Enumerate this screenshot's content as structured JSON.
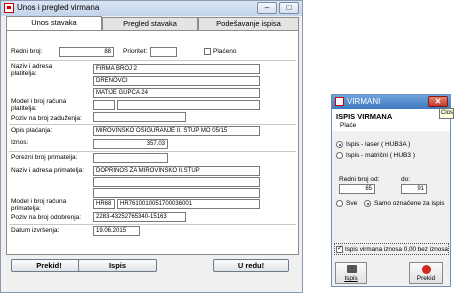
{
  "window": {
    "title": "Unos i pregled virmana"
  },
  "tabs": [
    "Unos stavaka",
    "Pregled stavaka",
    "Podešavanje ispisa"
  ],
  "form": {
    "redni_broj_label": "Redni broj:",
    "redni_broj": "88",
    "prioritet_label": "Prioritet:",
    "prioritet": "",
    "placeno_label": "Plaćeno",
    "platitelj_label": "Naziv i adresa platitelja:",
    "platitelj_line1": "FIRMA BROJ 2",
    "platitelj_line2": "DRENOVCI",
    "platitelj_line3": "MATIJE GUPCA 24",
    "model_platitelj_label": "Model i broj računa platitelja:",
    "poziv_zaduzenje_label": "Poziv na broj zaduženja:",
    "opis_label": "Opis plaćanja:",
    "opis": "MIROVINSKO OSIGURANJE II. STUP MO 05/15",
    "iznos_label": "Iznos:",
    "iznos": "357,03",
    "poreznibroj_label": "Porezni broj primatelja:",
    "primatelj_label": "Naziv i adresa primatelja:",
    "primatelj_line1": "DOPRINOS ZA MIROVINSKO II.STUP",
    "model_primatelj_label": "Model i broj računa primatelja:",
    "model_primatelj": "HR68",
    "racun_primatelj": "HR7610010051700036001",
    "poziv_odobrenje_label": "Poziv na broj odobrenja:",
    "poziv_odobrenje": "2283-43252765340-15163",
    "datum_label": "Datum izvršenja:",
    "datum": "19.06.2015"
  },
  "buttons": {
    "prekid": "Prekid!",
    "ispis": "Ispis",
    "uredu": "U redu!"
  },
  "dialog": {
    "title": "VIRMANI",
    "heading": "ISPIS VIRMANA",
    "subheading": "Plaće",
    "laser": "Ispis - laser   ( HUB3A )",
    "matricni": "Ispis - matrični   ( HUB3 )",
    "od_label": "Redni broj od:",
    "do_label": "do:",
    "od": "85",
    "do": "91",
    "sve": "Sve",
    "samo": "Samo označene za ispis",
    "nula": "Ispis virmana iznosa 0,00 bez iznosa",
    "ispis": "Ispis",
    "prekid": "Prekid"
  },
  "tooltip": "Close"
}
